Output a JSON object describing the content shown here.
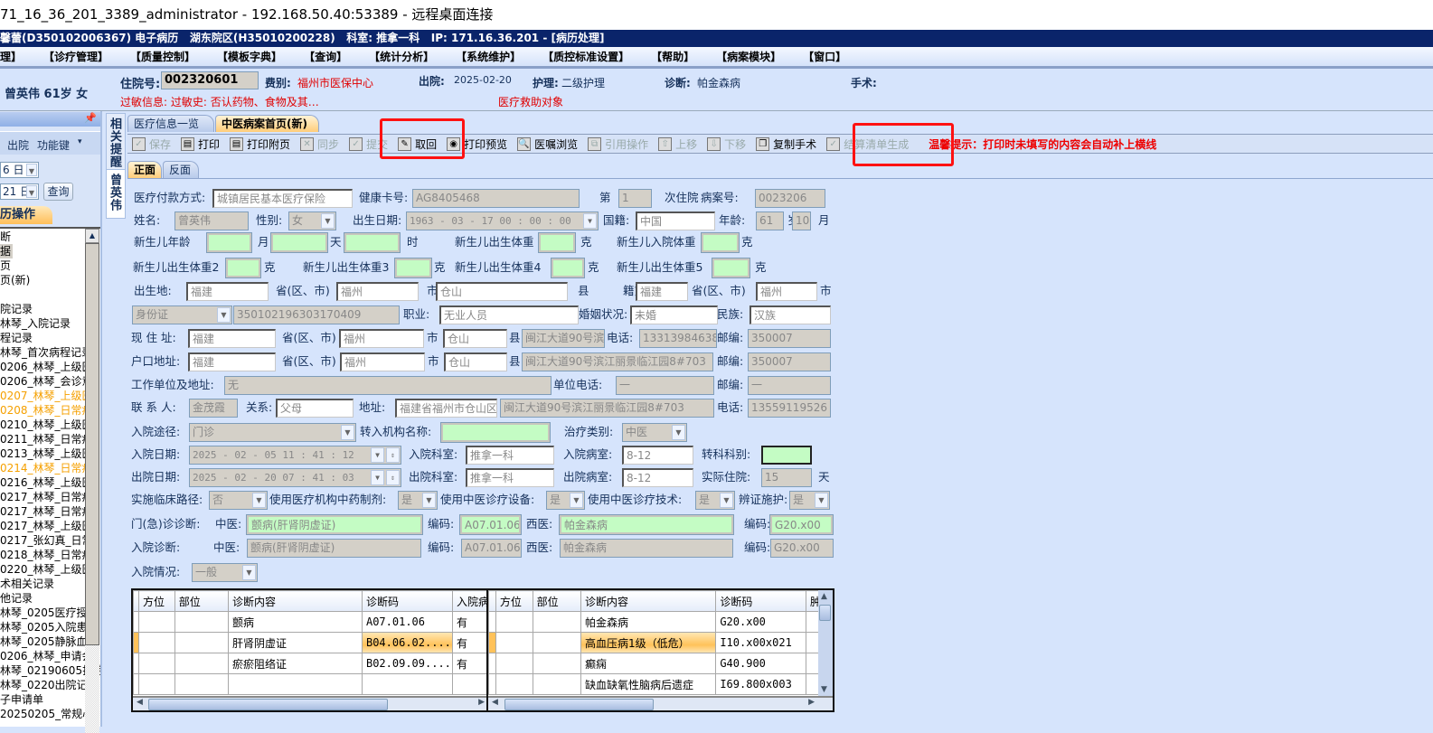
{
  "window_title": "71_16_36_201_3389_administrator - 192.168.50.40:53389 - 远程桌面连接",
  "app_title": "馨蕾(D350102006367) 电子病历   湖东院区(H35010200228)   科室: 推拿一科   IP: 171.16.36.201 - [病历处理]",
  "menu": [
    "理】",
    "【诊疗管理】",
    "【质量控制】",
    "【模板字典】",
    "【查询】",
    "【统计分析】",
    "【系统维护】",
    "【质控标准设置】",
    "【帮助】",
    "【病案模块】",
    "【窗口】"
  ],
  "patient": {
    "name_age_sex": "曾英伟 61岁 女",
    "admission_no_label": "住院号:",
    "admission_no": "002320601",
    "fee_label": "费别:",
    "fee": "福州市医保中心",
    "discharge_label": "出院:",
    "discharge": "2025-02-20",
    "nursing_label": "护理:",
    "nursing": "二级护理",
    "diagnosis_label": "诊断:",
    "diagnosis": "帕金森病",
    "surgery_label": "手术:",
    "allergy": "过敏信息: 过敏史: 否认药物、食物及其…",
    "aid": "医疗救助对象"
  },
  "left_panel": {
    "discharge_btn": "出院",
    "function_key": "功能键",
    "date1": "6 日",
    "date2": "21 日",
    "query_btn": "查询",
    "tab": "历操作",
    "items": [
      {
        "t": "断",
        "c": "n"
      },
      {
        "t": "据",
        "c": "h"
      },
      {
        "t": "页",
        "c": "n"
      },
      {
        "t": "页(新)",
        "c": "n"
      },
      {
        "t": "",
        "c": "n"
      },
      {
        "t": "院记录",
        "c": "n"
      },
      {
        "t": "林琴_入院记录",
        "c": "n"
      },
      {
        "t": "程记录",
        "c": "n"
      },
      {
        "t": "林琴_首次病程记录",
        "c": "n"
      },
      {
        "t": "0206_林琴_上级医",
        "c": "n"
      },
      {
        "t": "0206_林琴_会诊意",
        "c": "n"
      },
      {
        "t": "0207_林琴_上级医",
        "c": "o"
      },
      {
        "t": "0208_林琴_日常病",
        "c": "o"
      },
      {
        "t": "0210_林琴_上级医",
        "c": "n"
      },
      {
        "t": "0211_林琴_日常病",
        "c": "n"
      },
      {
        "t": "0213_林琴_上级医",
        "c": "n"
      },
      {
        "t": "0214_林琴_日常病",
        "c": "o"
      },
      {
        "t": "0216_林琴_上级医",
        "c": "n"
      },
      {
        "t": "0217_林琴_日常病",
        "c": "n"
      },
      {
        "t": "0217_林琴_日常病",
        "c": "n"
      },
      {
        "t": "0217_林琴_上级医",
        "c": "n"
      },
      {
        "t": "0217_张幻真_日常",
        "c": "n"
      },
      {
        "t": "0218_林琴_日常病",
        "c": "n"
      },
      {
        "t": "0220_林琴_上级医",
        "c": "n"
      },
      {
        "t": "术相关记录",
        "c": "n"
      },
      {
        "t": "他记录",
        "c": "n"
      },
      {
        "t": "林琴_0205医疗授权",
        "c": "n"
      },
      {
        "t": "林琴_0205入院患者",
        "c": "n"
      },
      {
        "t": "林琴_0205静脉血栓",
        "c": "n"
      },
      {
        "t": "0206_林琴_申请会",
        "c": "n"
      },
      {
        "t": "林琴_02190605拒绝",
        "c": "n"
      },
      {
        "t": "林琴_0220出院记录",
        "c": "n"
      },
      {
        "t": "子申请单",
        "c": "n"
      },
      {
        "t": "20250205_常规心E",
        "c": "n"
      }
    ]
  },
  "vtabs": {
    "reminder": "相关提醒",
    "patient": "曾英伟"
  },
  "tabs": [
    "医疗信息一览表",
    "中医病案首页(新)"
  ],
  "toolbar": [
    {
      "label": "保存",
      "icon": "check-icon",
      "enabled": false
    },
    {
      "label": "打印",
      "icon": "printer-icon",
      "enabled": true
    },
    {
      "label": "打印附页",
      "icon": "printer-icon",
      "enabled": true
    },
    {
      "label": "同步",
      "icon": "sync-icon",
      "enabled": false
    },
    {
      "label": "提交",
      "icon": "check-icon",
      "enabled": false
    },
    {
      "label": "取回",
      "icon": "retrieve-icon",
      "enabled": true
    },
    {
      "label": "打印预览",
      "icon": "preview-icon",
      "enabled": true
    },
    {
      "label": "医嘱浏览",
      "icon": "magnifier-icon",
      "enabled": true
    },
    {
      "label": "引用操作",
      "icon": "reference-icon",
      "enabled": false
    },
    {
      "label": "上移",
      "icon": "arrow-up-icon",
      "enabled": false
    },
    {
      "label": "下移",
      "icon": "arrow-down-icon",
      "enabled": false
    },
    {
      "label": "复制手术",
      "icon": "copy-icon",
      "enabled": true
    },
    {
      "label": "结算清单生成",
      "icon": "check-icon",
      "enabled": false
    }
  ],
  "tip": "温馨提示：打印时未填写的内容会自动补上横线",
  "subtabs": [
    "正面",
    "反面"
  ],
  "form": {
    "pay_l": "医疗付款方式:",
    "pay": "城镇居民基本医疗保险",
    "card_l": "健康卡号:",
    "card": "AG8405468",
    "nth_l": "第",
    "nth": "1",
    "nth_s": "次住院",
    "case_l": "病案号:",
    "case": "0023206",
    "name_l": "姓名:",
    "name": "曾英伟",
    "sex_l": "性别:",
    "sex": "女",
    "dob_l": "出生日期:",
    "dob": "1963 - 03 - 17   00 : 00 : 00",
    "nat_l": "国籍:",
    "nat": "中国",
    "age_l": "年龄:",
    "age": "61",
    "age_y": "岁",
    "age_m": "10",
    "age_ml": "月",
    "nb_age_l": "新生儿年龄",
    "u_month": "月",
    "u_day": "天",
    "u_hour": "时",
    "nb_w_l": "新生儿出生体重",
    "g": "克",
    "nb_in_l": "新生儿入院体重",
    "nb_w2_l": "新生儿出生体重2",
    "nb_w3_l": "新生儿出生体重3",
    "nb_w4_l": "新生儿出生体重4",
    "nb_w5_l": "新生儿出生体重5",
    "bp_l": "出生地:",
    "bp_p": "福建",
    "prov_l": "省(区、市)",
    "bp_c": "福州",
    "city_l": "市",
    "bp_d": "仓山",
    "county_l": "县",
    "np_l": "籍贯:",
    "np_p": "福建",
    "np_c": "福州",
    "id_type": "身份证",
    "id_no": "350102196303170409",
    "job_l": "职业:",
    "job": "无业人员",
    "mar_l": "婚姻状况:",
    "mar": "未婚",
    "eth_l": "民族:",
    "eth": "汉族",
    "cur_l": "现 住 址:",
    "cur_p": "福建",
    "cur_c": "福州",
    "cur_d": "仓山",
    "cur_addr": "闽江大道90号滨江丽景临江园8#703",
    "tel_l": "电话:",
    "cur_tel": "13313984638",
    "zip_l": "邮编:",
    "cur_zip": "350007",
    "hk_l": "户口地址:",
    "hk_p": "福建",
    "hk_c": "福州",
    "hk_d": "仓山",
    "hk_addr": "闽江大道90号滨江丽景临江园8#703",
    "hk_zip": "350007",
    "work_l": "工作单位及地址:",
    "work": "无",
    "wtel_l": "单位电话:",
    "wtel": "一",
    "wzip": "一",
    "ct_l": "联 系 人:",
    "ct": "金茂霞",
    "rel_l": "关系:",
    "rel": "父母",
    "ctaddr_l": "地址:",
    "ctaddr1": "福建省福州市仓山区",
    "ctaddr2": "闽江大道90号滨江丽景临江园8#703",
    "cttel": "13559119526",
    "route_l": "入院途径:",
    "route": "门诊",
    "tin_l": "转入机构名称:",
    "treat_l": "治疗类别:",
    "treat": "中医",
    "adm_l": "入院日期:",
    "adm": "2025 - 02 - 05   11 : 41 : 12",
    "admdept_l": "入院科室:",
    "admdept": "推拿一科",
    "admward_l": "入院病室:",
    "admward": "8-12",
    "transfer_l": "转科科别:",
    "dis_l": "出院日期:",
    "dis": "2025 - 02 - 20   07 : 41 : 03",
    "disdept_l": "出院科室:",
    "disdept": "推拿一科",
    "disward_l": "出院病室:",
    "disward": "8-12",
    "stay_l": "实际住院:",
    "stay": "15",
    "stay_u": "天",
    "path_l": "实施临床路径:",
    "path": "否",
    "herb_l": "使用医疗机构中药制剂:",
    "herb": "是",
    "dev_l": "使用中医诊疗设备:",
    "dev": "是",
    "tech_l": "使用中医诊疗技术:",
    "tech": "是",
    "nurse_l": "辨证施护:",
    "nurse": "是",
    "opd_l": "门(急)诊诊断:",
    "tcm_l": "中医:",
    "opd_tcm": "颤病(肝肾阴虚证)",
    "code_l": "编码:",
    "opd_tcm_code": "A07.01.06",
    "wm_l": "西医:",
    "opd_wm": "帕金森病",
    "opd_wm_code": "G20.x00",
    "admdx_l": "入院诊断:",
    "adm_tcm": "颤病(肝肾阴虚证)",
    "adm_tcm_code": "A07.01.06",
    "adm_wm": "帕金森病",
    "adm_wm_code": "G20.x00",
    "cond_l": "入院情况:",
    "cond": "一般"
  },
  "tcm_table": {
    "headers": [
      "方位",
      "部位",
      "诊断内容",
      "诊断码",
      "入院病"
    ],
    "rows": [
      [
        "",
        "",
        "颤病",
        "A07.01.06",
        "有"
      ],
      [
        "",
        "",
        "肝肾阴虚证",
        "B04.06.02....",
        "有"
      ],
      [
        "",
        "",
        "瘀瘀阻络证",
        "B02.09.09....",
        "有"
      ],
      [
        "",
        "",
        "",
        "",
        ""
      ]
    ]
  },
  "wm_table": {
    "headers": [
      "方位",
      "部位",
      "诊断内容",
      "诊断码",
      "肿"
    ],
    "rows": [
      [
        "",
        "",
        "帕金森病",
        "G20.x00",
        ""
      ],
      [
        "",
        "",
        "高血压病1级（低危）",
        "I10.x00x021",
        ""
      ],
      [
        "",
        "",
        "癫痫",
        "G40.900",
        ""
      ],
      [
        "",
        "",
        "缺血缺氧性脑病后遗症",
        "I69.800x003",
        ""
      ]
    ]
  }
}
